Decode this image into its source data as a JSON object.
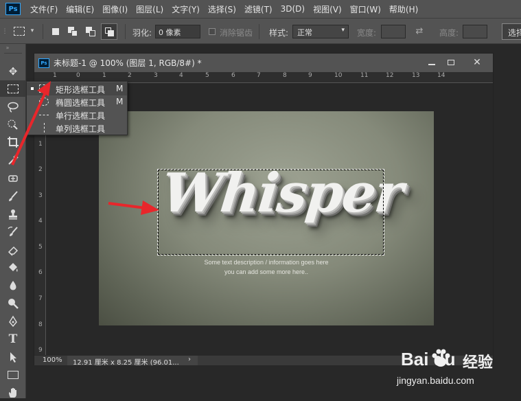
{
  "app": {
    "logo": "Ps"
  },
  "menubar": {
    "items": [
      "文件(F)",
      "编辑(E)",
      "图像(I)",
      "图层(L)",
      "文字(Y)",
      "选择(S)",
      "滤镜(T)",
      "3D(D)",
      "视图(V)",
      "窗口(W)",
      "帮助(H)"
    ]
  },
  "options": {
    "feather_label": "羽化:",
    "feather_value": "0 像素",
    "antialias_label": "消除锯齿",
    "style_label": "样式:",
    "style_value": "正常",
    "width_label": "宽度:",
    "height_label": "高度:",
    "select_label": "选择"
  },
  "document": {
    "title": "未标题-1 @ 100% (图层 1, RGB/8#) *",
    "ruler_h": [
      "1",
      "0",
      "1",
      "2",
      "3",
      "4",
      "5",
      "6",
      "7",
      "8",
      "9",
      "10",
      "11",
      "12",
      "13",
      "14"
    ],
    "ruler_v": [
      "1",
      "2",
      "3",
      "4",
      "5",
      "6",
      "7",
      "8",
      "9"
    ],
    "artwork_title": "Whisper",
    "desc_line1": "Some text description / information goes here",
    "desc_line2": "you can add some more here..",
    "zoom": "100%",
    "doc_size": "12.91 厘米 x 8.25 厘米 (96.01...",
    "status_arrow": "›"
  },
  "flyout": {
    "items": [
      {
        "label": "矩形选框工具",
        "key": "M",
        "active": true,
        "icon": "rect-marquee-icon"
      },
      {
        "label": "椭圆选框工具",
        "key": "M",
        "active": false,
        "icon": "ellipse-marquee-icon"
      },
      {
        "label": "单行选框工具",
        "key": "",
        "active": false,
        "icon": "single-row-marquee-icon"
      },
      {
        "label": "单列选框工具",
        "key": "",
        "active": false,
        "icon": "single-column-marquee-icon"
      }
    ]
  },
  "watermark": {
    "brand": "Bai  du",
    "brand_cn": "经验",
    "url": "jingyan.baidu.com"
  },
  "colors": {
    "accent": "#31a8ff",
    "arrow": "#e8262b",
    "panel": "#535353",
    "background": "#282828"
  }
}
